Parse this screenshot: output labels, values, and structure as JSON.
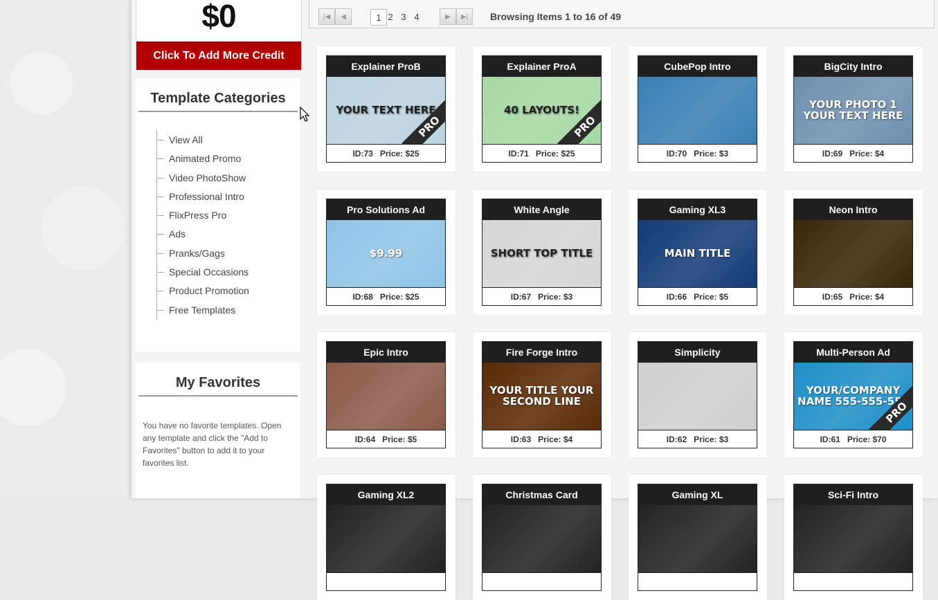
{
  "credit": {
    "amount": "$0",
    "button_label": "Click To Add More Credit"
  },
  "categories": {
    "title": "Template Categories",
    "items": [
      "View All",
      "Animated Promo",
      "Video PhotoShow",
      "Professional Intro",
      "FlixPress Pro",
      "Ads",
      "Pranks/Gags",
      "Special Occasions",
      "Product Promotion",
      "Free Templates"
    ]
  },
  "favorites": {
    "title": "My Favorites",
    "text": "You have no favorite templates. Open any template and click the \"Add to Favorites\" button to add it to your favorites list."
  },
  "pager": {
    "pages": [
      "1",
      "2",
      "3",
      "4"
    ],
    "current": "1",
    "browse_prefix": "Browsing Items ",
    "browse_from": "1",
    "browse_mid": " to ",
    "browse_to": "16",
    "browse_of": " of ",
    "browse_total": "49",
    "icons": [
      "first-page-icon",
      "prev-page-icon",
      "next-page-icon",
      "last-page-icon"
    ]
  },
  "templates": [
    {
      "title": "Explainer ProB",
      "id": "ID:73",
      "price": "Price: $25",
      "thumb_text": "YOUR TEXT HERE",
      "pro": "PRO",
      "bg": "#bcd3e0"
    },
    {
      "title": "Explainer ProA",
      "id": "ID:71",
      "price": "Price: $25",
      "thumb_text": "40 LAYOUTS!",
      "pro": "PRO",
      "bg": "#a6d8a4"
    },
    {
      "title": "CubePop Intro",
      "id": "ID:70",
      "price": "Price: $3",
      "thumb_text": "",
      "pro": "",
      "bg": "#3a7fb5"
    },
    {
      "title": "BigCity Intro",
      "id": "ID:69",
      "price": "Price: $4",
      "thumb_text": "YOUR PHOTO 1 YOUR TEXT HERE",
      "pro": "",
      "bg": "#6f8fb0"
    },
    {
      "title": "Pro Solutions Ad",
      "id": "ID:68",
      "price": "Price: $25",
      "thumb_text": "$9.99",
      "pro": "",
      "bg": "#8fc3e6"
    },
    {
      "title": "White Angle",
      "id": "ID:67",
      "price": "Price: $3",
      "thumb_text": "SHORT TOP TITLE",
      "pro": "",
      "bg": "#d6d6d6"
    },
    {
      "title": "Gaming XL3",
      "id": "ID:66",
      "price": "Price: $5",
      "thumb_text": "MAIN TITLE",
      "pro": "",
      "bg": "#143a78"
    },
    {
      "title": "Neon Intro",
      "id": "ID:65",
      "price": "Price: $4",
      "thumb_text": "",
      "pro": "",
      "bg": "#3a2608"
    },
    {
      "title": "Epic Intro",
      "id": "ID:64",
      "price": "Price: $5",
      "thumb_text": "",
      "pro": "",
      "bg": "#8a5a4a"
    },
    {
      "title": "Fire Forge Intro",
      "id": "ID:63",
      "price": "Price: $4",
      "thumb_text": "YOUR TITLE YOUR SECOND LINE",
      "pro": "",
      "bg": "#5a2a05"
    },
    {
      "title": "Simplicity",
      "id": "ID:62",
      "price": "Price: $3",
      "thumb_text": "",
      "pro": "",
      "bg": "#cfcfcf"
    },
    {
      "title": "Multi-Person Ad",
      "id": "ID:61",
      "price": "Price: $70",
      "thumb_text": "YOUR/COMPANY NAME 555-555-555",
      "pro": "PRO",
      "bg": "#1e8fc7"
    },
    {
      "title": "Gaming XL2",
      "id": "",
      "price": "",
      "thumb_text": "",
      "pro": "",
      "bg": "#222"
    },
    {
      "title": "Christmas Card",
      "id": "",
      "price": "",
      "thumb_text": "",
      "pro": "",
      "bg": "#222"
    },
    {
      "title": "Gaming XL",
      "id": "",
      "price": "",
      "thumb_text": "",
      "pro": "",
      "bg": "#222"
    },
    {
      "title": "Sci-Fi Intro",
      "id": "",
      "price": "",
      "thumb_text": "",
      "pro": "",
      "bg": "#222"
    }
  ]
}
